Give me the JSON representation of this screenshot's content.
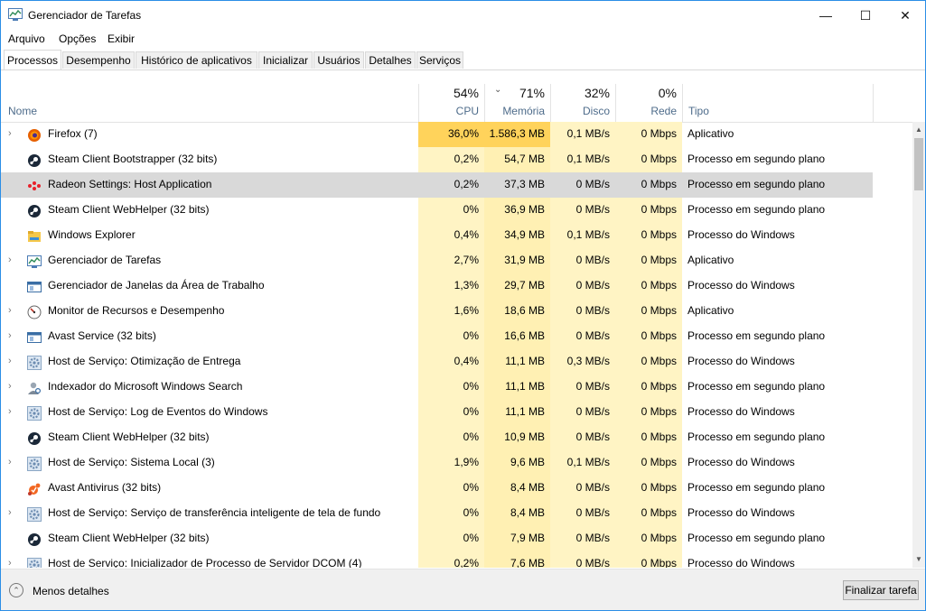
{
  "window": {
    "title": "Gerenciador de Tarefas",
    "controls": {
      "minimize": "—",
      "maximize": "☐",
      "close": "✕"
    }
  },
  "menu": [
    "Arquivo",
    "Opções",
    "Exibir"
  ],
  "tabs": [
    "Processos",
    "Desempenho",
    "Histórico de aplicativos",
    "Inicializar",
    "Usuários",
    "Detalhes",
    "Serviços"
  ],
  "active_tab": "Processos",
  "columns": {
    "name": "Nome",
    "cpu": {
      "percent": "54%",
      "label": "CPU"
    },
    "memory": {
      "percent": "71%",
      "label": "Memória"
    },
    "disk": {
      "percent": "32%",
      "label": "Disco"
    },
    "network": {
      "percent": "0%",
      "label": "Rede"
    },
    "type": "Tipo"
  },
  "processes": [
    {
      "expand": "›",
      "icon": "firefox-icon",
      "name": "Firefox (7)",
      "cpu": "36,0%",
      "mem": "1.586,3 MB",
      "disk": "0,1 MB/s",
      "net": "0 Mbps",
      "type": "Aplicativo"
    },
    {
      "expand": "",
      "icon": "steam-icon",
      "name": "Steam Client Bootstrapper (32 bits)",
      "cpu": "0,2%",
      "mem": "54,7 MB",
      "disk": "0,1 MB/s",
      "net": "0 Mbps",
      "type": "Processo em segundo plano"
    },
    {
      "expand": "",
      "icon": "radeon-icon",
      "name": "Radeon Settings: Host Application",
      "cpu": "0,2%",
      "mem": "37,3 MB",
      "disk": "0 MB/s",
      "net": "0 Mbps",
      "type": "Processo em segundo plano",
      "selected": true
    },
    {
      "expand": "",
      "icon": "steam-icon",
      "name": "Steam Client WebHelper (32 bits)",
      "cpu": "0%",
      "mem": "36,9 MB",
      "disk": "0 MB/s",
      "net": "0 Mbps",
      "type": "Processo em segundo plano"
    },
    {
      "expand": "",
      "icon": "explorer-icon",
      "name": "Windows Explorer",
      "cpu": "0,4%",
      "mem": "34,9 MB",
      "disk": "0,1 MB/s",
      "net": "0 Mbps",
      "type": "Processo do Windows"
    },
    {
      "expand": "›",
      "icon": "taskmgr-icon",
      "name": "Gerenciador de Tarefas",
      "cpu": "2,7%",
      "mem": "31,9 MB",
      "disk": "0 MB/s",
      "net": "0 Mbps",
      "type": "Aplicativo"
    },
    {
      "expand": "",
      "icon": "window-icon",
      "name": "Gerenciador de Janelas da Área de Trabalho",
      "cpu": "1,3%",
      "mem": "29,7 MB",
      "disk": "0 MB/s",
      "net": "0 Mbps",
      "type": "Processo do Windows"
    },
    {
      "expand": "›",
      "icon": "resmon-icon",
      "name": "Monitor de Recursos e Desempenho",
      "cpu": "1,6%",
      "mem": "18,6 MB",
      "disk": "0 MB/s",
      "net": "0 Mbps",
      "type": "Aplicativo"
    },
    {
      "expand": "›",
      "icon": "window-icon",
      "name": "Avast Service (32 bits)",
      "cpu": "0%",
      "mem": "16,6 MB",
      "disk": "0 MB/s",
      "net": "0 Mbps",
      "type": "Processo em segundo plano"
    },
    {
      "expand": "›",
      "icon": "gear-icon",
      "name": "Host de Serviço: Otimização de Entrega",
      "cpu": "0,4%",
      "mem": "11,1 MB",
      "disk": "0,3 MB/s",
      "net": "0 Mbps",
      "type": "Processo do Windows"
    },
    {
      "expand": "›",
      "icon": "user-search-icon",
      "name": "Indexador do Microsoft Windows Search",
      "cpu": "0%",
      "mem": "11,1 MB",
      "disk": "0 MB/s",
      "net": "0 Mbps",
      "type": "Processo em segundo plano"
    },
    {
      "expand": "›",
      "icon": "gear-icon",
      "name": "Host de Serviço: Log de Eventos do Windows",
      "cpu": "0%",
      "mem": "11,1 MB",
      "disk": "0 MB/s",
      "net": "0 Mbps",
      "type": "Processo do Windows"
    },
    {
      "expand": "",
      "icon": "steam-icon",
      "name": "Steam Client WebHelper (32 bits)",
      "cpu": "0%",
      "mem": "10,9 MB",
      "disk": "0 MB/s",
      "net": "0 Mbps",
      "type": "Processo em segundo plano"
    },
    {
      "expand": "›",
      "icon": "gear-icon",
      "name": "Host de Serviço: Sistema Local (3)",
      "cpu": "1,9%",
      "mem": "9,6 MB",
      "disk": "0,1 MB/s",
      "net": "0 Mbps",
      "type": "Processo do Windows"
    },
    {
      "expand": "",
      "icon": "avast-icon",
      "name": "Avast Antivirus (32 bits)",
      "cpu": "0%",
      "mem": "8,4 MB",
      "disk": "0 MB/s",
      "net": "0 Mbps",
      "type": "Processo em segundo plano"
    },
    {
      "expand": "›",
      "icon": "gear-icon",
      "name": "Host de Serviço: Serviço de transferência inteligente de tela de fundo",
      "cpu": "0%",
      "mem": "8,4 MB",
      "disk": "0 MB/s",
      "net": "0 Mbps",
      "type": "Processo do Windows"
    },
    {
      "expand": "",
      "icon": "steam-icon",
      "name": "Steam Client WebHelper (32 bits)",
      "cpu": "0%",
      "mem": "7,9 MB",
      "disk": "0 MB/s",
      "net": "0 Mbps",
      "type": "Processo em segundo plano"
    },
    {
      "expand": "›",
      "icon": "gear-icon",
      "name": "Host de Serviço: Inicializador de Processo de Servidor DCOM (4)",
      "cpu": "0,2%",
      "mem": "7,6 MB",
      "disk": "0 MB/s",
      "net": "0 Mbps",
      "type": "Processo do Windows"
    }
  ],
  "footer": {
    "fewer_details": "Menos detalhes",
    "end_task": "Finalizar tarefa"
  },
  "colors": {
    "heat_high": "#ffd35b",
    "heat_mid": "#fff0b3",
    "heat_low": "#fff4c4",
    "selection": "#d9d9d9",
    "header_label": "#4d6b8a"
  }
}
